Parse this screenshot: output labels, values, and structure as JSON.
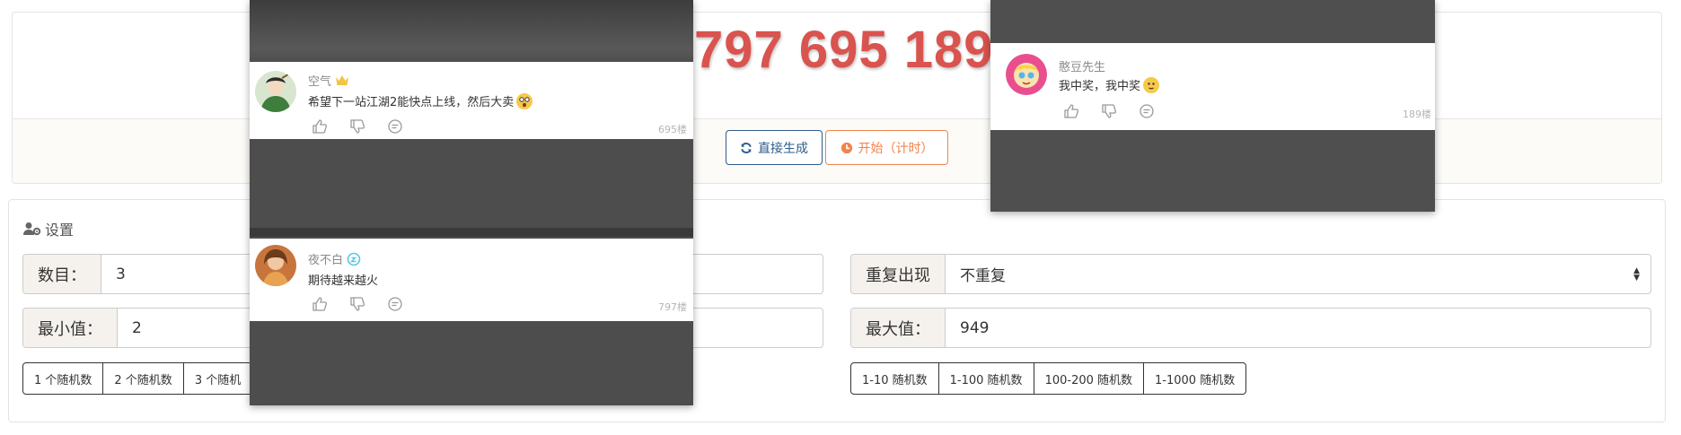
{
  "result": {
    "number_display": "797 695 189"
  },
  "actions": {
    "generate_label": "直接生成",
    "start_label": "开始（计时）"
  },
  "settings": {
    "title": "设置",
    "count_label": "数目：",
    "count_value": "3",
    "repeat_label": "重复出现",
    "repeat_value": "不重复",
    "min_label": "最小值：",
    "min_value": "2",
    "max_label": "最大值：",
    "max_value": "949",
    "count_presets": [
      "1 个随机数",
      "2 个随机数",
      "3 个随机"
    ],
    "range_presets": [
      "1-10 随机数",
      "1-100 随机数",
      "100-200 随机数",
      "1-1000 随机数"
    ]
  },
  "comments": [
    {
      "user": "空气",
      "text": "希望下一站江湖2能快点上线，然后大卖",
      "floor": "695楼",
      "badge": "crown-icon",
      "emoji": "surprised-emoji"
    },
    {
      "user": "夜不白",
      "text": "期待越来越火",
      "floor": "797楼",
      "badge": "level-icon"
    },
    {
      "user": "憨豆先生",
      "text": "我中奖，我中奖",
      "floor": "189楼",
      "emoji": "smile-emoji"
    }
  ],
  "colors": {
    "result_number": "#d9534f",
    "generate_button": "#2e5c8a",
    "start_button": "#f0844d",
    "overlay": "#4a4a4a"
  }
}
